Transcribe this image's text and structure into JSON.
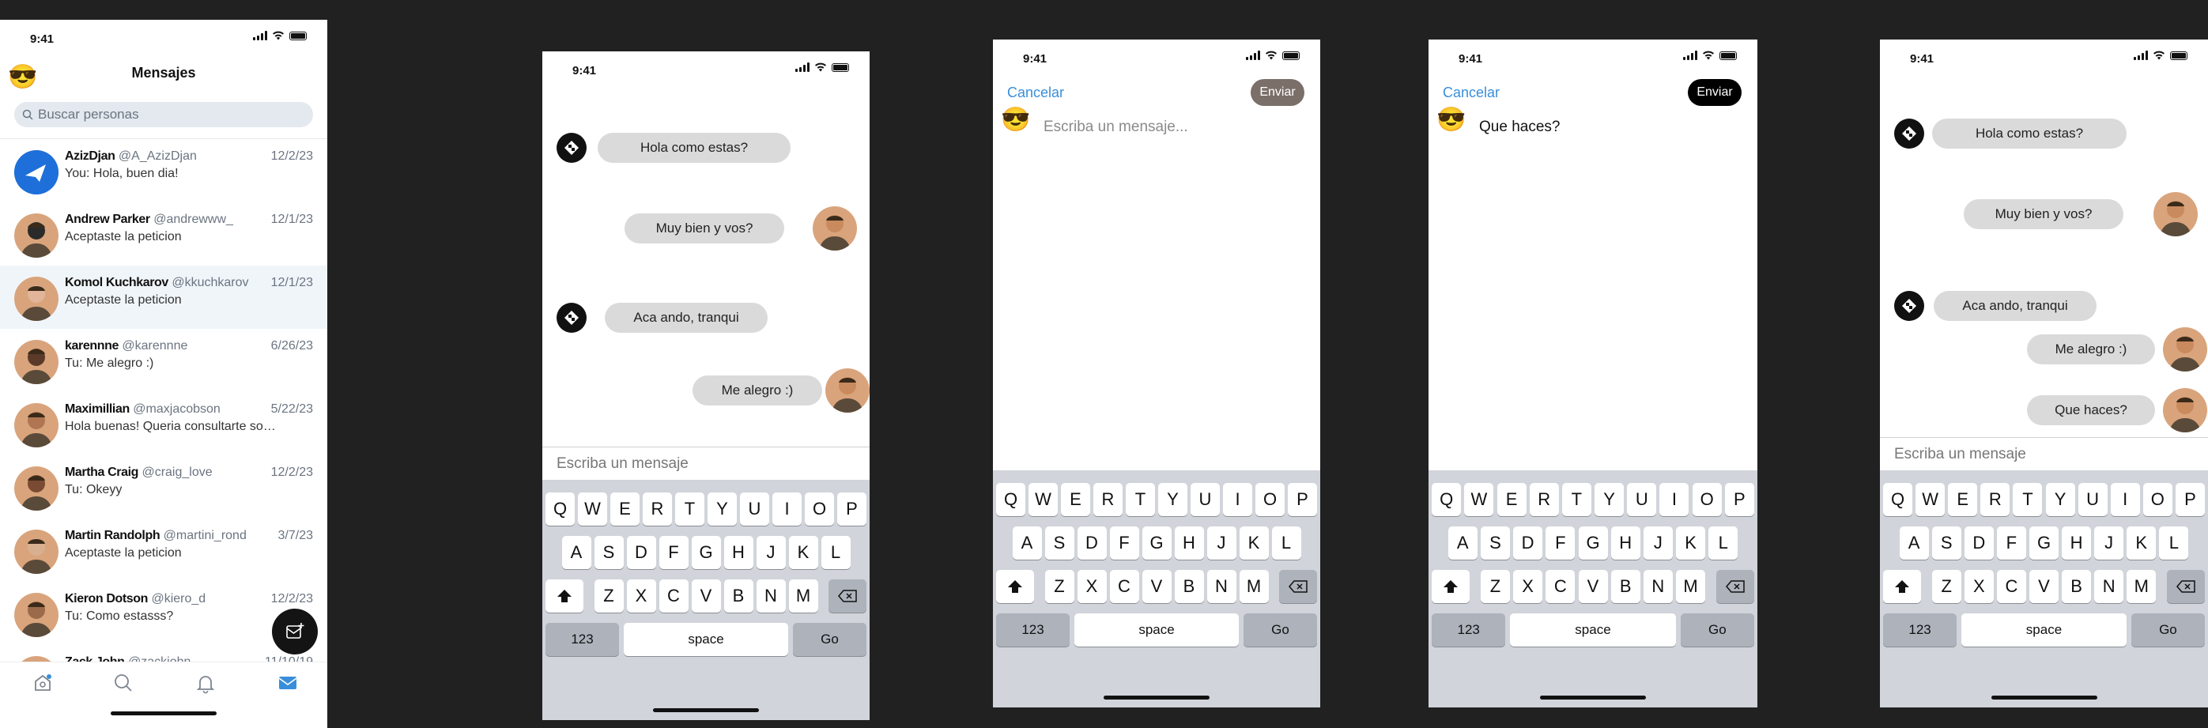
{
  "status": {
    "time": "9:41"
  },
  "inbox": {
    "header_emoji": "😎",
    "title": "Mensajes",
    "search_placeholder": "Buscar personas",
    "conversations": [
      {
        "name": "AzizDjan",
        "handle": "@A_AzizDjan",
        "date": "12/2/23",
        "message": "You: Hola, buen dia!",
        "avatar": "bird-logo"
      },
      {
        "name": "Andrew Parker",
        "handle": "@andrewww_",
        "date": "12/1/23",
        "message": "Aceptaste la peticion",
        "avatar": "photo"
      },
      {
        "name": "Komol Kuchkarov",
        "handle": "@kkuchkarov",
        "date": "12/1/23",
        "message": "Aceptaste la peticion",
        "avatar": "photo"
      },
      {
        "name": "karennne",
        "handle": "@karennne",
        "date": "6/26/23",
        "message": "Tu: Me alegro :)",
        "avatar": "photo"
      },
      {
        "name": "Maximillian",
        "handle": "@maxjacobson",
        "date": "5/22/23",
        "message": "Hola buenas! Queria consultarte sobre un tema",
        "avatar": "photo"
      },
      {
        "name": "Martha Craig",
        "handle": "@craig_love",
        "date": "12/2/23",
        "message": "Tu: Okeyy",
        "avatar": "photo"
      },
      {
        "name": "Martin Randolph",
        "handle": "@martini_rond",
        "date": "3/7/23",
        "message": "Aceptaste la peticion",
        "avatar": "photo"
      },
      {
        "name": "Kieron Dotson",
        "handle": "@kiero_d",
        "date": "12/2/23",
        "message": "Tu: Como estasss?",
        "avatar": "photo"
      },
      {
        "name": "Zack John",
        "handle": "@zackjohn",
        "date": "11/10/19",
        "message": "",
        "avatar": "photo"
      }
    ],
    "tabs": [
      "home-icon",
      "search-icon",
      "bell-icon",
      "mail-icon"
    ]
  },
  "chat1": {
    "messages": [
      {
        "text": "Hola como estas?",
        "from": "other"
      },
      {
        "text": "Muy bien y vos?",
        "from": "me"
      },
      {
        "text": "Aca ando, tranqui",
        "from": "other"
      },
      {
        "text": "Me alegro :)",
        "from": "me"
      }
    ],
    "input_placeholder": "Escriba un mensaje"
  },
  "compose_empty": {
    "cancel": "Cancelar",
    "send": "Enviar",
    "send_color": "#7a6f69",
    "emoji": "😎",
    "placeholder": "Escriba un mensaje..."
  },
  "compose_filled": {
    "cancel": "Cancelar",
    "send": "Enviar",
    "send_color": "#000000",
    "emoji": "😎",
    "text": "Que haces?"
  },
  "chat2": {
    "messages": [
      {
        "text": "Hola como estas?",
        "from": "other"
      },
      {
        "text": "Muy bien y vos?",
        "from": "me"
      },
      {
        "text": "Aca ando, tranqui",
        "from": "other"
      },
      {
        "text": "Me alegro :)",
        "from": "me"
      },
      {
        "text": "Que haces?",
        "from": "me"
      }
    ],
    "input_placeholder": "Escriba un mensaje"
  },
  "keyboard": {
    "row1": [
      "Q",
      "W",
      "E",
      "R",
      "T",
      "Y",
      "U",
      "I",
      "O",
      "P"
    ],
    "row2": [
      "A",
      "S",
      "D",
      "F",
      "G",
      "H",
      "J",
      "K",
      "L"
    ],
    "row3": [
      "Z",
      "X",
      "C",
      "V",
      "B",
      "N",
      "M"
    ],
    "numbers": "123",
    "space": "space",
    "go": "Go"
  },
  "colors": {
    "accent": "#3a8ed9",
    "bubble": "#dadada",
    "keyboard": "#d1d4da",
    "background": "#212121"
  }
}
